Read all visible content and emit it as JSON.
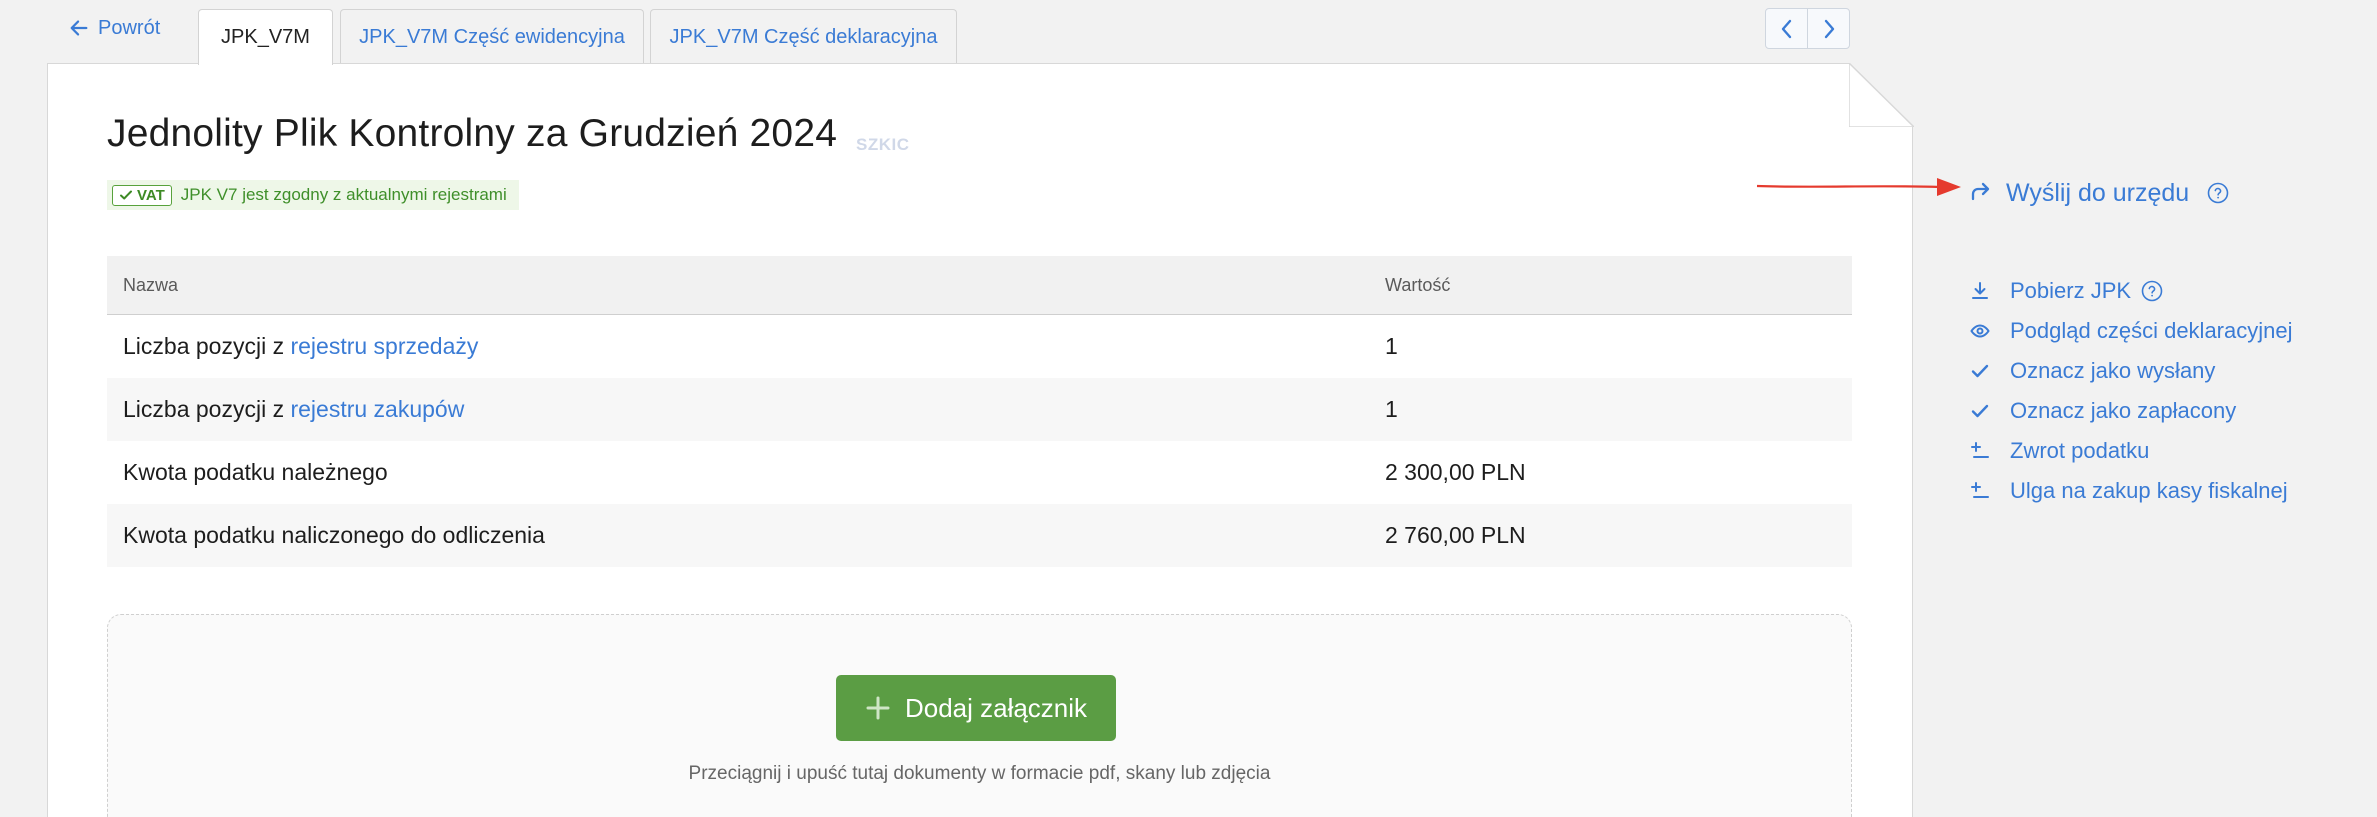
{
  "nav": {
    "back_label": "Powrót",
    "tabs": [
      {
        "label": "JPK_V7M",
        "active": true
      },
      {
        "label": "JPK_V7M Część ewidencyjna",
        "active": false
      },
      {
        "label": "JPK_V7M Część deklaracyjna",
        "active": false
      }
    ],
    "arrows": [
      "chevron-left-icon",
      "chevron-right-icon"
    ]
  },
  "document": {
    "title": "Jednolity Plik Kontrolny za Grudzień 2024",
    "status": "SZKIC",
    "vat_badge": "VAT",
    "vat_message": "JPK V7 jest zgodny z aktualnymi rejestrami"
  },
  "table": {
    "headers": {
      "name": "Nazwa",
      "value": "Wartość"
    },
    "rows": [
      {
        "prefix": "Liczba pozycji z ",
        "link": "rejestru sprzedaży",
        "value": "1"
      },
      {
        "prefix": "Liczba pozycji z ",
        "link": "rejestru zakupów",
        "value": "1"
      },
      {
        "prefix": "Kwota podatku należnego",
        "link": "",
        "value": "2 300,00 PLN"
      },
      {
        "prefix": "Kwota podatku naliczonego do odliczenia",
        "link": "",
        "value": "2 760,00 PLN"
      }
    ]
  },
  "attachments": {
    "add_label": "Dodaj załącznik",
    "hint": "Przeciągnij i upuść tutaj dokumenty w formacie pdf, skany lub zdjęcia"
  },
  "sidebar": {
    "send_label": "Wyślij do urzędu",
    "actions": [
      {
        "label": "Pobierz JPK",
        "icon": "download-icon",
        "help": true
      },
      {
        "label": "Podgląd części deklaracyjnej",
        "icon": "eye-icon",
        "help": false
      },
      {
        "label": "Oznacz jako wysłany",
        "icon": "check-icon",
        "help": false
      },
      {
        "label": "Oznacz jako zapłacony",
        "icon": "check-icon",
        "help": false
      },
      {
        "label": "Zwrot podatku",
        "icon": "plus-minus-icon",
        "help": false
      },
      {
        "label": "Ulga na zakup kasy fiskalnej",
        "icon": "plus-minus-icon",
        "help": false
      }
    ]
  },
  "colors": {
    "link": "#3a7bd5",
    "success": "#5b9d44",
    "annotation": "#e53a2e"
  }
}
